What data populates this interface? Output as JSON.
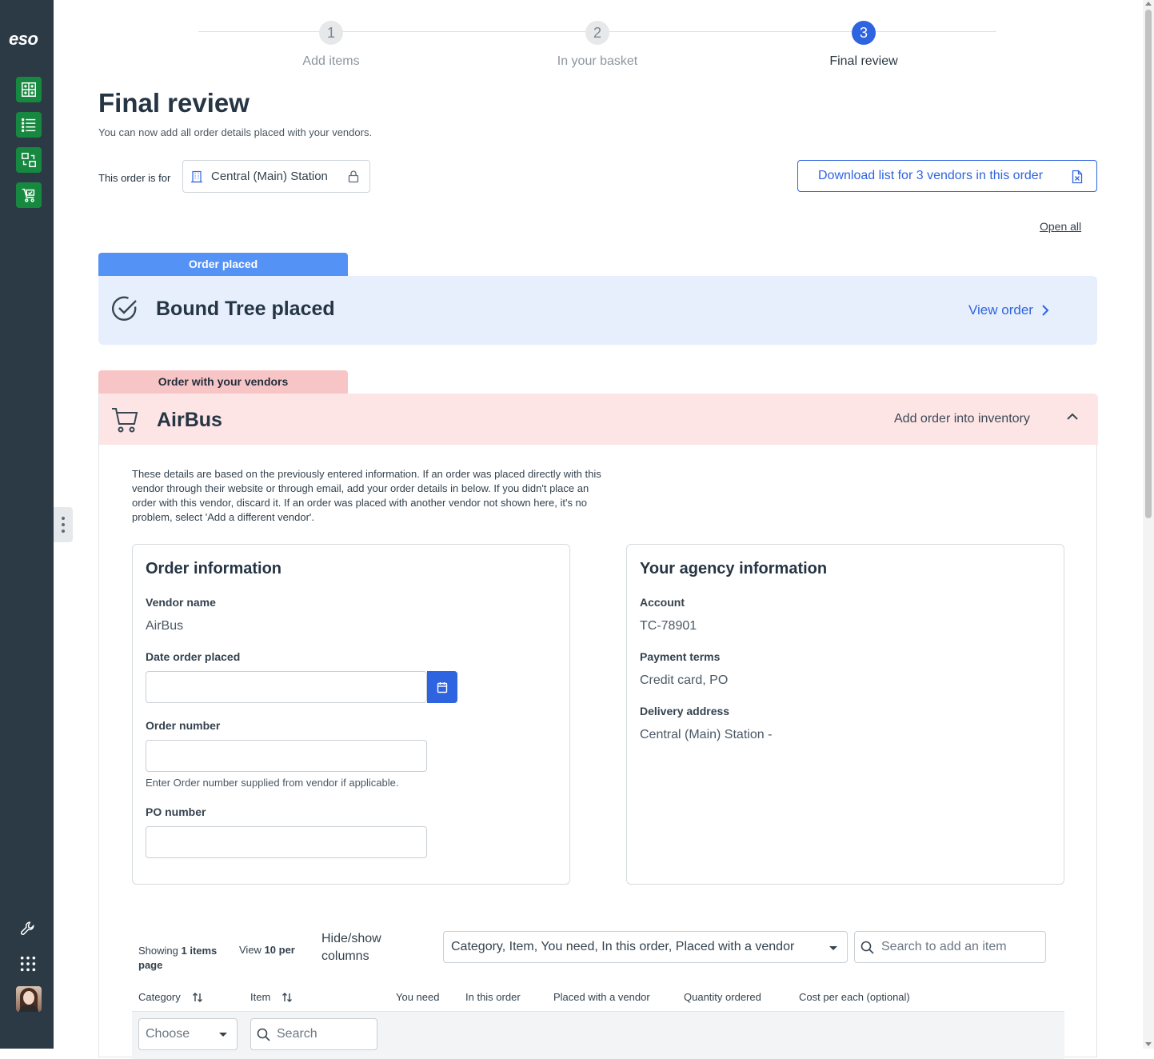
{
  "sidebar": {
    "logo": "eso",
    "nav_icons": [
      "add-items-icon",
      "list-icon",
      "transfer-icon",
      "cart-check-icon"
    ],
    "tools": [
      "wrench-icon",
      "apps-grid-icon"
    ]
  },
  "stepper": {
    "steps": [
      {
        "num": "1",
        "label": "Add items"
      },
      {
        "num": "2",
        "label": "In your basket"
      },
      {
        "num": "3",
        "label": "Final review"
      }
    ],
    "active": 3
  },
  "page": {
    "title": "Final review",
    "subtitle": "You can now add all order details placed with your vendors.",
    "order_for_label": "This order is for",
    "station": "Central (Main) Station",
    "download_label": "Download list for 3 vendors in this order",
    "open_all": "Open all"
  },
  "placed_card": {
    "tag": "Order placed",
    "title": "Bound Tree placed",
    "view_order": "View order"
  },
  "vendor_card": {
    "tag": "Order with your vendors",
    "title": "AirBus",
    "add_inventory": "Add order into inventory",
    "description": "These details are based on the previously entered information. If an order was placed directly with this vendor through their website or through email, add your order details in below. If you didn't place an order with this vendor, discard it. If an order was placed with another vendor not shown here, it's no problem, select 'Add a different vendor'."
  },
  "order_info": {
    "heading": "Order information",
    "vendor_name_label": "Vendor name",
    "vendor_name": "AirBus",
    "date_label": "Date order placed",
    "date_value": "",
    "order_number_label": "Order number",
    "order_number_value": "",
    "order_number_help": "Enter Order number supplied from vendor if applicable.",
    "po_label": "PO number",
    "po_value": ""
  },
  "agency_info": {
    "heading": "Your agency information",
    "account_label": "Account",
    "account": "TC-78901",
    "payment_label": "Payment terms",
    "payment": "Credit card, PO",
    "delivery_label": "Delivery address",
    "delivery": "Central (Main) Station -"
  },
  "table": {
    "showing_prefix": "Showing ",
    "showing_count": "1 items",
    "view_prefix": "View ",
    "view_count": "10 per",
    "page_word": "page",
    "hide_show": "Hide/show columns",
    "columns_selected": "Category, Item, You need, In this order, Placed with a vendor",
    "search_placeholder": "Search to add an item",
    "headers": [
      "Category",
      "Item",
      "You need",
      "In this order",
      "Placed with a vendor",
      "Quantity ordered",
      "Cost per each (optional)"
    ],
    "filter_choose": "Choose",
    "filter_search": "Search"
  },
  "colors": {
    "sidebar": "#2b3a45",
    "nav_green": "#17883f",
    "accent_blue": "#2f64e0",
    "placed_tag": "#5492f5",
    "placed_bg": "#e7effd",
    "vendor_tag": "#f8c5c6",
    "vendor_bg": "#fde5e5"
  }
}
